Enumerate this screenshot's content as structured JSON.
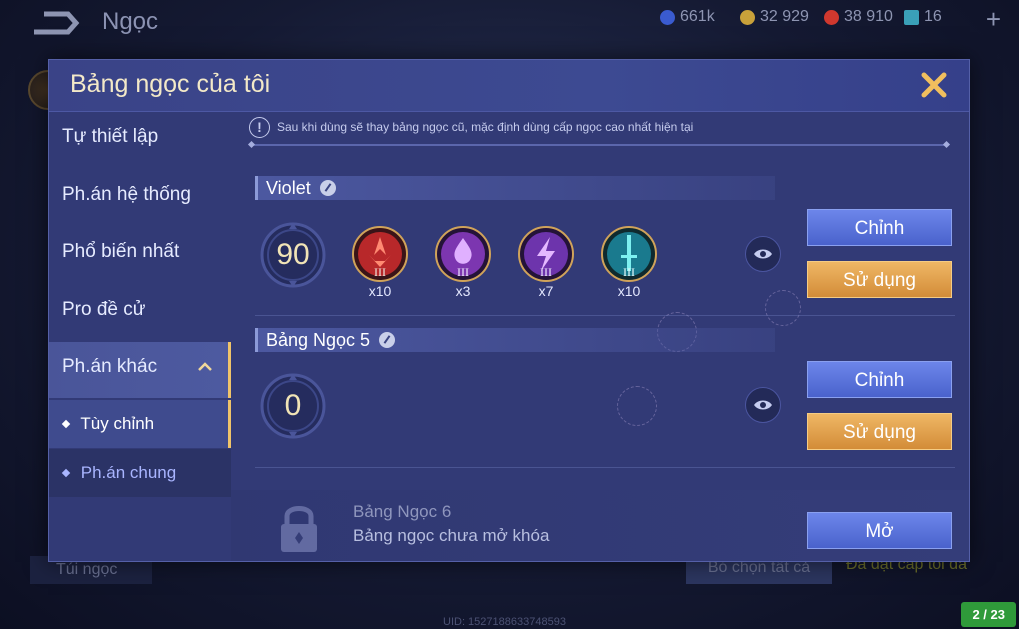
{
  "topbar": {
    "title": "Ngọc",
    "resources": [
      {
        "value": "661k",
        "color": "#3a5bd0"
      },
      {
        "value": "32 929",
        "color": "#c8a13a"
      },
      {
        "value": "38 910",
        "color": "#d0382e"
      },
      {
        "value": "16",
        "color": "#3aa0b8"
      }
    ]
  },
  "background": {
    "bottom_left_label": "Túi ngọc",
    "bottom_button": "Bỏ chọn tất cả",
    "bottom_status": "Đã đạt cấp tối đa",
    "uid": "UID: 1527188633748593"
  },
  "modal": {
    "title": "Bảng ngọc của tôi",
    "notice": "Sau khi dùng sẽ thay bảng ngọc cũ, mặc định dùng cấp ngọc cao nhất hiện tại",
    "notice_icon": "!",
    "sidebar": {
      "items": [
        {
          "label": "Tự thiết lập"
        },
        {
          "label": "Ph.án hệ thống"
        },
        {
          "label": "Phổ biến nhất"
        },
        {
          "label": "Pro đề cử"
        },
        {
          "label": "Ph.án khác"
        }
      ],
      "subitems": [
        {
          "label": "Tùy chỉnh"
        },
        {
          "label": "Ph.án chung"
        }
      ]
    },
    "pages": [
      {
        "name": "Violet",
        "level": "90",
        "gems": [
          {
            "tier": "III",
            "count": "x10",
            "color": "#c0302a",
            "icon": "red-gem-icon"
          },
          {
            "tier": "III",
            "count": "x3",
            "color": "#8a3ec0",
            "icon": "purple-drop-gem-icon"
          },
          {
            "tier": "III",
            "count": "x7",
            "color": "#7d3cb8",
            "icon": "purple-bolt-gem-icon"
          },
          {
            "tier": "III",
            "count": "x10",
            "color": "#1f8aa8",
            "icon": "green-sword-gem-icon"
          }
        ],
        "edit_label": "Chỉnh",
        "use_label": "Sử dụng"
      },
      {
        "name": "Bảng Ngọc 5",
        "level": "0",
        "gems": [],
        "edit_label": "Chỉnh",
        "use_label": "Sử dụng"
      }
    ],
    "locked": {
      "name": "Bảng Ngọc 6",
      "status": "Bảng ngọc chưa mở khóa",
      "open_label": "Mở"
    }
  },
  "page_indicator": "2 / 23",
  "colors": {
    "accent_gold": "#f0c46a",
    "button_blue": "#5a72d8",
    "button_orange": "#e2a04c"
  }
}
